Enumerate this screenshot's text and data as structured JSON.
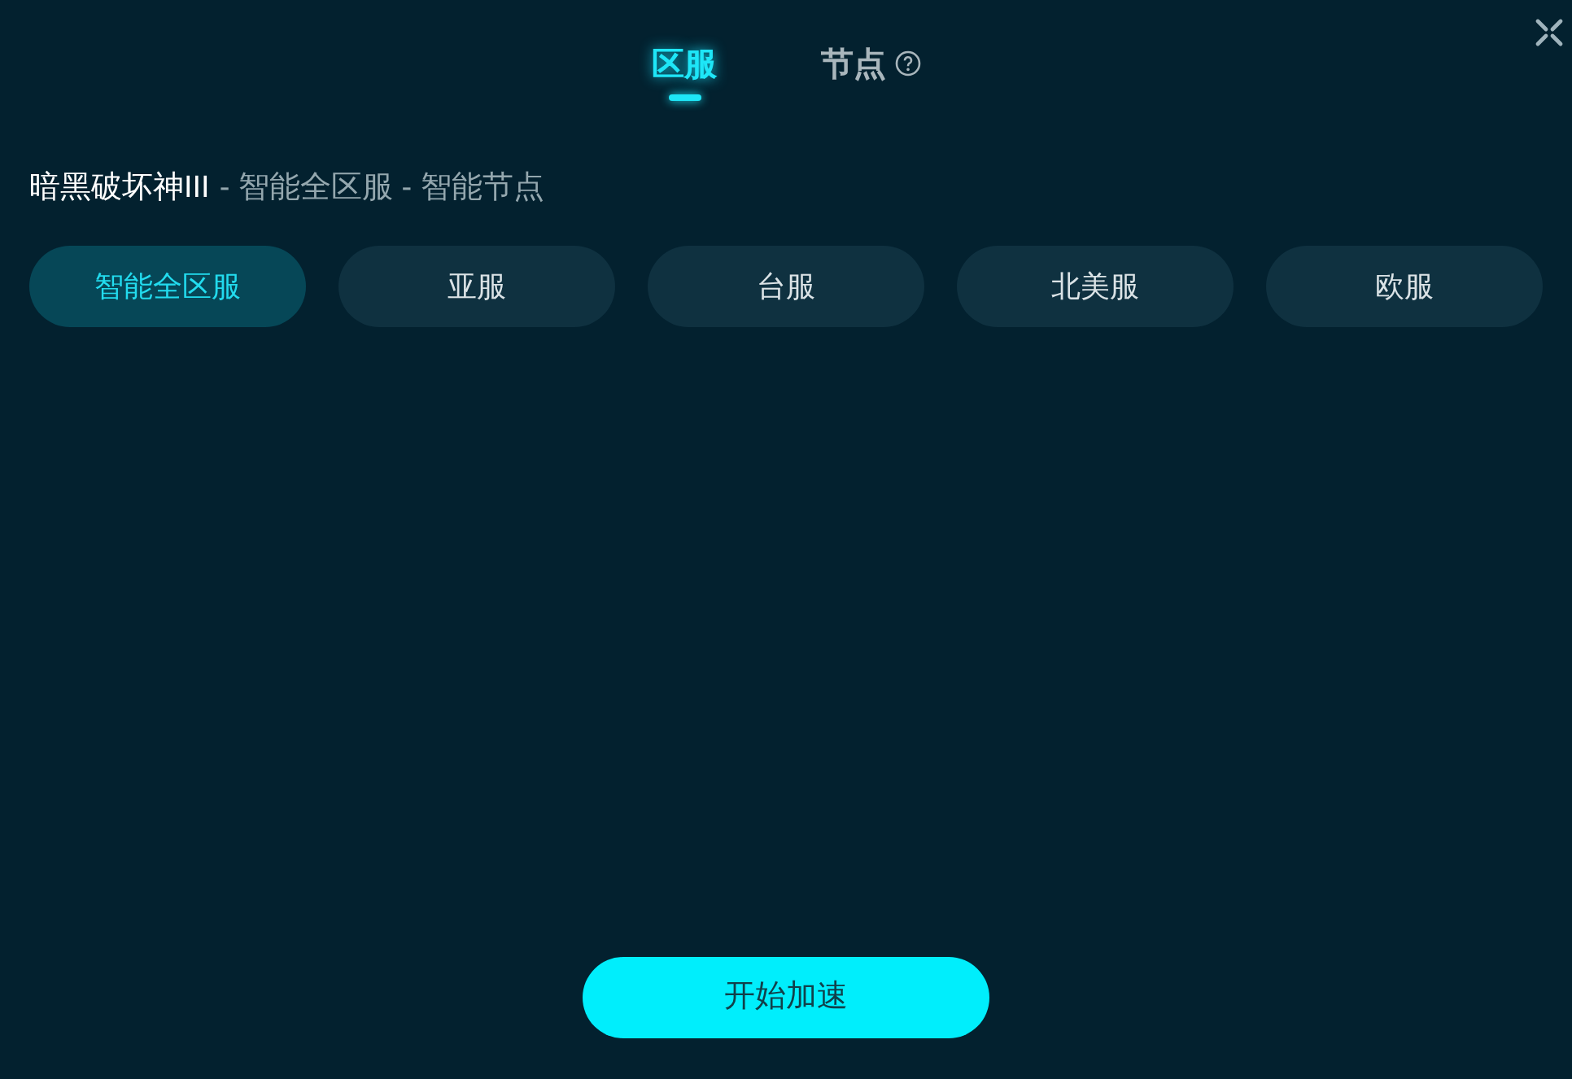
{
  "tabs": [
    {
      "label": "区服",
      "selected": true,
      "help": false
    },
    {
      "label": "节点",
      "selected": false,
      "help": true
    }
  ],
  "breadcrumb": {
    "game": "暗黑破坏神III",
    "path": "- 智能全区服 - 智能节点"
  },
  "regions": [
    {
      "label": "智能全区服",
      "selected": true
    },
    {
      "label": "亚服",
      "selected": false
    },
    {
      "label": "台服",
      "selected": false
    },
    {
      "label": "北美服",
      "selected": false
    },
    {
      "label": "欧服",
      "selected": false
    }
  ],
  "start_button": "开始加速"
}
